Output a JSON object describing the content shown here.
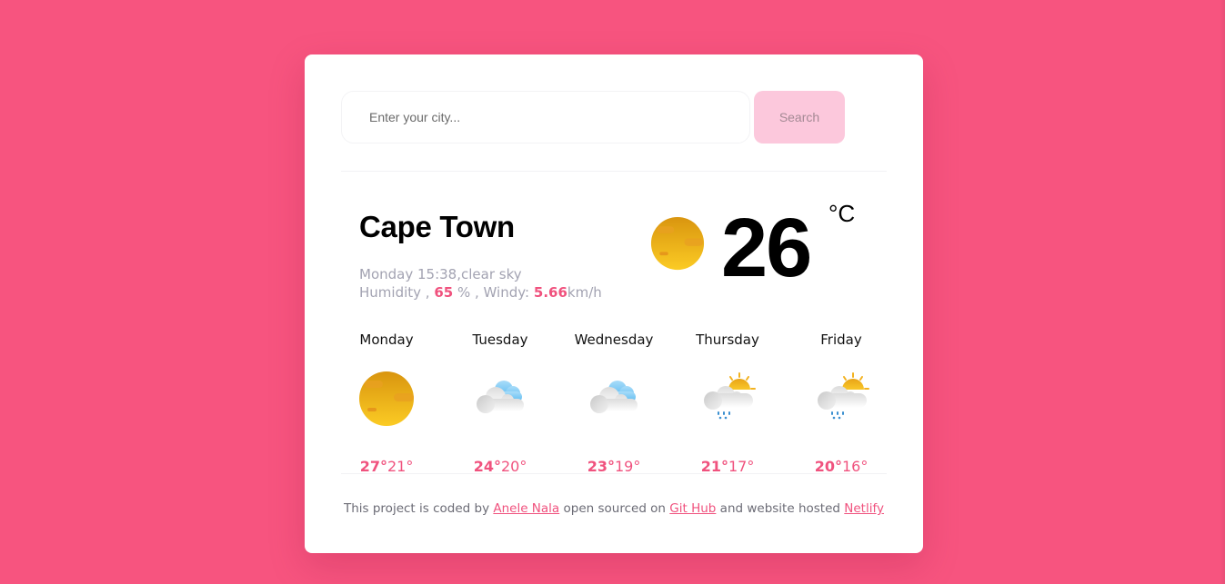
{
  "search": {
    "placeholder": "Enter your city...",
    "value": "",
    "button_label": "Search"
  },
  "current": {
    "city": "Cape Town",
    "day_time_desc": "Monday 15:38,clear sky",
    "humidity_label": "Humidity ,",
    "humidity_value": "65",
    "humidity_unit": "% , Windy:",
    "wind_value": "5.66",
    "wind_unit": "km/h",
    "temperature": "26",
    "unit": "°C",
    "icon": "clear-sky-sun-icon"
  },
  "forecast": [
    {
      "day": "Monday",
      "icon": "clear-sky-sun-icon",
      "max": "27°",
      "min": "21°"
    },
    {
      "day": "Tuesday",
      "icon": "cloudy-icon",
      "max": "24°",
      "min": "20°"
    },
    {
      "day": "Wednesday",
      "icon": "cloudy-icon",
      "max": "23°",
      "min": "19°"
    },
    {
      "day": "Thursday",
      "icon": "sun-cloud-rain-icon",
      "max": "21°",
      "min": "17°"
    },
    {
      "day": "Friday",
      "icon": "sun-cloud-rain-icon",
      "max": "20°",
      "min": "16°"
    }
  ],
  "footer": {
    "text1": "This project is coded by",
    "author_link": "Anele Nala",
    "text2": "open sourced on",
    "github_link": "Git Hub",
    "text3": "and website hosted",
    "netlify_link": "Netlify"
  },
  "colors": {
    "background": "#f7547f",
    "accent": "#f0527e",
    "search_button": "#fcc8dc",
    "muted_text": "#a3a3b2"
  }
}
